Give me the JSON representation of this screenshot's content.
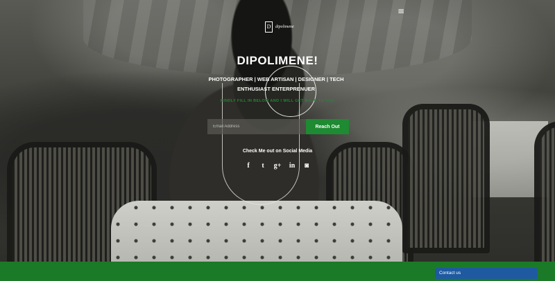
{
  "menu": {
    "icon": "hamburger-menu-icon",
    "glyph": "≡"
  },
  "logo": {
    "mark": "D",
    "text": "dipolimene"
  },
  "hero": {
    "title": "DIPOLIMENE!",
    "subtitle": "PHOTOGRAPHER | WEB ARTISAN | DESIGNER | TECH ENTHUSIAST ENTERPRENUER",
    "kindly_note": "KINDLY FILL IN BELOW AND I WILL GET BACK TO YOU"
  },
  "form": {
    "email_placeholder": "Email Address",
    "email_value": "",
    "submit_label": "Reach Out"
  },
  "social": {
    "label": "Check Me out on Social Media",
    "links": [
      {
        "icon": "facebook-icon",
        "glyph": "f"
      },
      {
        "icon": "twitter-icon",
        "glyph": "t"
      },
      {
        "icon": "google-plus-icon",
        "glyph": "g+"
      },
      {
        "icon": "linkedin-icon",
        "glyph": "in"
      },
      {
        "icon": "instagram-icon",
        "glyph": "◙"
      }
    ]
  },
  "contact_tab": {
    "label": "Contact us"
  },
  "colors": {
    "accent_green": "#1e8a31",
    "footer_green": "#1b7a27",
    "contact_blue": "#1f5aa0"
  }
}
